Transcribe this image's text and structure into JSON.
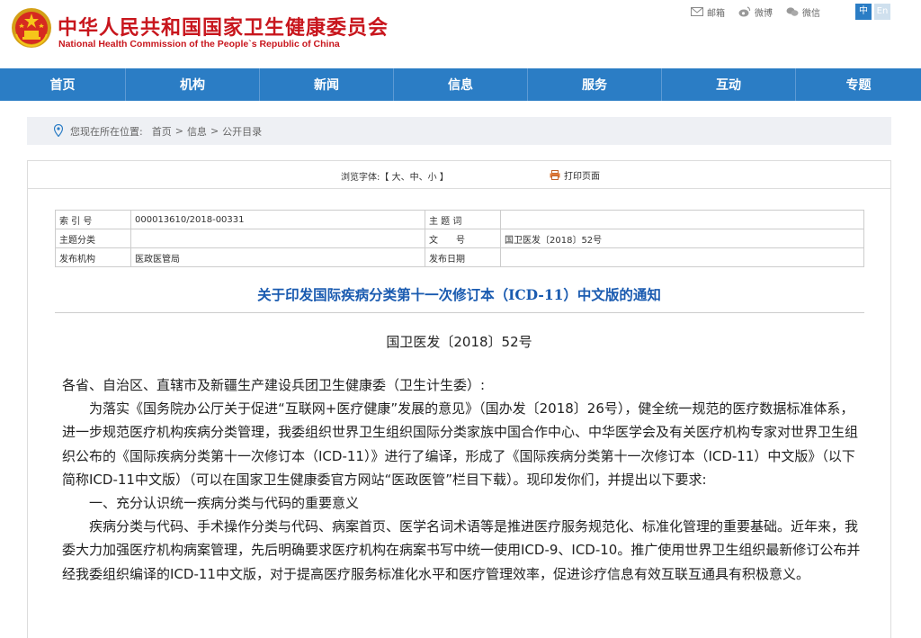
{
  "header": {
    "title": "中华人民共和国国家卫生健康委员会",
    "subtitle": "National Health Commission of the People`s Republic of China",
    "links": [
      {
        "icon": "mail-icon",
        "label": "邮箱"
      },
      {
        "icon": "weibo-icon",
        "label": "微博"
      },
      {
        "icon": "wechat-icon",
        "label": "微信"
      }
    ],
    "lang_zh": "中",
    "lang_en": "En"
  },
  "nav": {
    "items": [
      "首页",
      "机构",
      "新闻",
      "信息",
      "服务",
      "互动",
      "专题"
    ]
  },
  "breadcrumb": {
    "label": "您现在所在位置:",
    "items": [
      "首页",
      "信息",
      "公开目录"
    ],
    "separator": ">"
  },
  "toolbar": {
    "font_label": "浏览字体:【",
    "font_large": "大",
    "font_medium": "中",
    "font_small": "小",
    "font_end": "】",
    "font_sep": "、",
    "print_label": "打印页面"
  },
  "meta": {
    "index_label": "索 引 号",
    "index_value": "000013610/2018-00331",
    "subject_word_label": "主 题 词",
    "subject_word_value": "",
    "category_label": "主题分类",
    "category_value": "",
    "doc_no_label": "文　　号",
    "doc_no_value": "国卫医发〔2018〕52号",
    "issuer_label": "发布机构",
    "issuer_value": "医政医管局",
    "date_label": "发布日期",
    "date_value": ""
  },
  "document": {
    "title": "关于印发国际疾病分类第十一次修订本（ICD-11）中文版的通知",
    "number": "国卫医发〔2018〕52号",
    "salutation": "各省、自治区、直辖市及新疆生产建设兵团卫生健康委（卫生计生委）:",
    "para1": "为落实《国务院办公厅关于促进“互联网+医疗健康”发展的意见》（国办发〔2018〕26号），健全统一规范的医疗数据标准体系，进一步规范医疗机构疾病分类管理，我委组织世界卫生组织国际分类家族中国合作中心、中华医学会及有关医疗机构专家对世界卫生组织公布的《国际疾病分类第十一次修订本（ICD-11）》进行了编译，形成了《国际疾病分类第十一次修订本（ICD-11）中文版》（以下简称ICD-11中文版）（可以在国家卫生健康委官方网站“医政医管”栏目下载）。现印发你们，并提出以下要求:",
    "section1": "一、充分认识统一疾病分类与代码的重要意义",
    "para2": "疾病分类与代码、手术操作分类与代码、病案首页、医学名词术语等是推进医疗服务规范化、标准化管理的重要基础。近年来，我委大力加强医疗机构病案管理，先后明确要求医疗机构在病案书写中统一使用ICD-9、ICD-10。推广使用世界卫生组织最新修订公布并经我委组织编译的ICD-11中文版，对于提高医疗服务标准化水平和医疗管理效率，促进诊疗信息有效互联互通具有积极意义。"
  },
  "colors": {
    "brand_red": "#c8161d",
    "nav_blue": "#2b7dc5",
    "title_blue": "#1a5bb0"
  }
}
